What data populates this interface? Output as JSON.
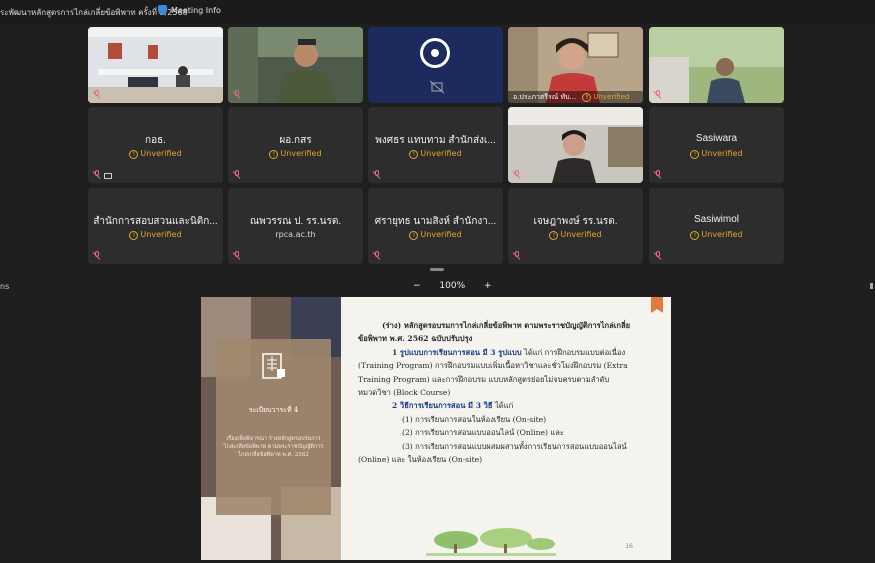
{
  "meeting": {
    "title": "ระพัฒนาหลักสูตรการไกล่เกลี่ยข้อพิพาท ครั้งที่ 2/2568",
    "info_label": "Meeting Info"
  },
  "unverified_label": "Unverified",
  "tiles": [
    {
      "kind": "video",
      "label": ""
    },
    {
      "kind": "video",
      "label": ""
    },
    {
      "kind": "logo",
      "label": ""
    },
    {
      "kind": "video",
      "label": "อ.ประภาสรีรณ์ ทับ...",
      "unverified": true,
      "active": true
    },
    {
      "kind": "video",
      "label": ""
    },
    {
      "kind": "name",
      "name": "กอธ.",
      "unverified": true,
      "screen": true
    },
    {
      "kind": "name",
      "name": "ผอ.กสร",
      "unverified": true
    },
    {
      "kind": "name",
      "name": "พงศธร แทบทาม สำนักส่งเ...",
      "unverified": true
    },
    {
      "kind": "video",
      "label": ""
    },
    {
      "kind": "name",
      "name": "Sasiwara",
      "unverified": true
    },
    {
      "kind": "name",
      "name": "สำนักการสอบสวนและนิติก...",
      "unverified": true
    },
    {
      "kind": "name",
      "name": "ณพวรรณ ป. รร.นรต.",
      "sub": "rpca.ac.th"
    },
    {
      "kind": "name",
      "name": "ศรายุทธ นามสิงห์ สำนักงา...",
      "unverified": true
    },
    {
      "kind": "name",
      "name": "เจษฎาพงษ์ รร.นรต.",
      "unverified": true
    },
    {
      "kind": "name",
      "name": "Sasiwimol",
      "unverified": true
    }
  ],
  "zoom": {
    "minus": "−",
    "value": "100%",
    "plus": "+"
  },
  "side_label": "ns",
  "slide": {
    "card_title": "ระเบียบวาระที่ 4",
    "card_sub": "เรื่องเพื่อพิจารณา ร่างหลักสูตรอบรมการไกล่เกลี่ยข้อพิพาท ตามพระราชบัญญัติการไกล่เกลี่ยข้อพิพาท พ.ศ. 2562",
    "l1": "(ร่าง) หลักสูตรอบรมการไกล่เกลี่ยข้อพิพาท ตามพระราชบัญญัติการไกล่เกลี่ย",
    "l2": "ข้อพิพาท พ.ศ. 2562 ฉบับปรับปรุง",
    "l3a": "1 รูปแบบการเรียนการสอน มี 3 รูปแบบ",
    "l3b": " ได้แก่ การฝึกอบรมแบบต่อเนื่อง",
    "l4": "(Training Program) การฝึกอบรมแบบเพิ่มเนื้อหาวิชาและชั่วโมงฝึกอบรม (Extra",
    "l5": "Training Program) และการฝึกอบรม แบบหลักสูตรย่อยไม่จบครบตามลำดับ",
    "l6": "หมวดวิชา (Block Course)",
    "l7a": "2 วิธีการเรียนการสอน มี 3 วิธี",
    "l7b": " ได้แก่",
    "l8": "(1) การเรียนการสอนในห้องเรียน (On-site)",
    "l9": "(2) การเรียนการสอนแบบออนไลน์ (Online) และ",
    "l10": "(3) การเรียนการสอนแบบผสมผสานทั้งการเรียนการสอนแบบออนไลน์",
    "l11": "(Online) และ ในห้องเรียน (On-site)",
    "page": "16"
  },
  "colors": {
    "accent": "#2fc0a6",
    "warning": "#e3a72b",
    "muted_mic": "#e86b7a"
  }
}
